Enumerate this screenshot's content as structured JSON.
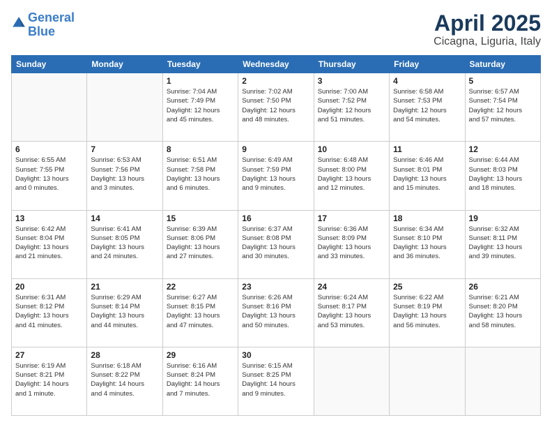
{
  "header": {
    "logo_line1": "General",
    "logo_line2": "Blue",
    "month": "April 2025",
    "location": "Cicagna, Liguria, Italy"
  },
  "weekdays": [
    "Sunday",
    "Monday",
    "Tuesday",
    "Wednesday",
    "Thursday",
    "Friday",
    "Saturday"
  ],
  "weeks": [
    [
      {
        "day": "",
        "info": ""
      },
      {
        "day": "",
        "info": ""
      },
      {
        "day": "1",
        "info": "Sunrise: 7:04 AM\nSunset: 7:49 PM\nDaylight: 12 hours\nand 45 minutes."
      },
      {
        "day": "2",
        "info": "Sunrise: 7:02 AM\nSunset: 7:50 PM\nDaylight: 12 hours\nand 48 minutes."
      },
      {
        "day": "3",
        "info": "Sunrise: 7:00 AM\nSunset: 7:52 PM\nDaylight: 12 hours\nand 51 minutes."
      },
      {
        "day": "4",
        "info": "Sunrise: 6:58 AM\nSunset: 7:53 PM\nDaylight: 12 hours\nand 54 minutes."
      },
      {
        "day": "5",
        "info": "Sunrise: 6:57 AM\nSunset: 7:54 PM\nDaylight: 12 hours\nand 57 minutes."
      }
    ],
    [
      {
        "day": "6",
        "info": "Sunrise: 6:55 AM\nSunset: 7:55 PM\nDaylight: 13 hours\nand 0 minutes."
      },
      {
        "day": "7",
        "info": "Sunrise: 6:53 AM\nSunset: 7:56 PM\nDaylight: 13 hours\nand 3 minutes."
      },
      {
        "day": "8",
        "info": "Sunrise: 6:51 AM\nSunset: 7:58 PM\nDaylight: 13 hours\nand 6 minutes."
      },
      {
        "day": "9",
        "info": "Sunrise: 6:49 AM\nSunset: 7:59 PM\nDaylight: 13 hours\nand 9 minutes."
      },
      {
        "day": "10",
        "info": "Sunrise: 6:48 AM\nSunset: 8:00 PM\nDaylight: 13 hours\nand 12 minutes."
      },
      {
        "day": "11",
        "info": "Sunrise: 6:46 AM\nSunset: 8:01 PM\nDaylight: 13 hours\nand 15 minutes."
      },
      {
        "day": "12",
        "info": "Sunrise: 6:44 AM\nSunset: 8:03 PM\nDaylight: 13 hours\nand 18 minutes."
      }
    ],
    [
      {
        "day": "13",
        "info": "Sunrise: 6:42 AM\nSunset: 8:04 PM\nDaylight: 13 hours\nand 21 minutes."
      },
      {
        "day": "14",
        "info": "Sunrise: 6:41 AM\nSunset: 8:05 PM\nDaylight: 13 hours\nand 24 minutes."
      },
      {
        "day": "15",
        "info": "Sunrise: 6:39 AM\nSunset: 8:06 PM\nDaylight: 13 hours\nand 27 minutes."
      },
      {
        "day": "16",
        "info": "Sunrise: 6:37 AM\nSunset: 8:08 PM\nDaylight: 13 hours\nand 30 minutes."
      },
      {
        "day": "17",
        "info": "Sunrise: 6:36 AM\nSunset: 8:09 PM\nDaylight: 13 hours\nand 33 minutes."
      },
      {
        "day": "18",
        "info": "Sunrise: 6:34 AM\nSunset: 8:10 PM\nDaylight: 13 hours\nand 36 minutes."
      },
      {
        "day": "19",
        "info": "Sunrise: 6:32 AM\nSunset: 8:11 PM\nDaylight: 13 hours\nand 39 minutes."
      }
    ],
    [
      {
        "day": "20",
        "info": "Sunrise: 6:31 AM\nSunset: 8:12 PM\nDaylight: 13 hours\nand 41 minutes."
      },
      {
        "day": "21",
        "info": "Sunrise: 6:29 AM\nSunset: 8:14 PM\nDaylight: 13 hours\nand 44 minutes."
      },
      {
        "day": "22",
        "info": "Sunrise: 6:27 AM\nSunset: 8:15 PM\nDaylight: 13 hours\nand 47 minutes."
      },
      {
        "day": "23",
        "info": "Sunrise: 6:26 AM\nSunset: 8:16 PM\nDaylight: 13 hours\nand 50 minutes."
      },
      {
        "day": "24",
        "info": "Sunrise: 6:24 AM\nSunset: 8:17 PM\nDaylight: 13 hours\nand 53 minutes."
      },
      {
        "day": "25",
        "info": "Sunrise: 6:22 AM\nSunset: 8:19 PM\nDaylight: 13 hours\nand 56 minutes."
      },
      {
        "day": "26",
        "info": "Sunrise: 6:21 AM\nSunset: 8:20 PM\nDaylight: 13 hours\nand 58 minutes."
      }
    ],
    [
      {
        "day": "27",
        "info": "Sunrise: 6:19 AM\nSunset: 8:21 PM\nDaylight: 14 hours\nand 1 minute."
      },
      {
        "day": "28",
        "info": "Sunrise: 6:18 AM\nSunset: 8:22 PM\nDaylight: 14 hours\nand 4 minutes."
      },
      {
        "day": "29",
        "info": "Sunrise: 6:16 AM\nSunset: 8:24 PM\nDaylight: 14 hours\nand 7 minutes."
      },
      {
        "day": "30",
        "info": "Sunrise: 6:15 AM\nSunset: 8:25 PM\nDaylight: 14 hours\nand 9 minutes."
      },
      {
        "day": "",
        "info": ""
      },
      {
        "day": "",
        "info": ""
      },
      {
        "day": "",
        "info": ""
      }
    ]
  ]
}
